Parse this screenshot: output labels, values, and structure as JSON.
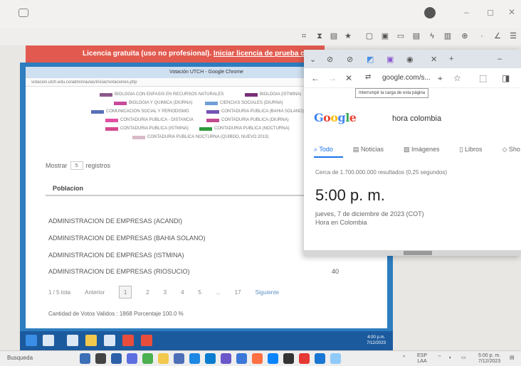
{
  "license": {
    "text": "Licencia gratuita (uso no profesional).",
    "link": "Iniciar licencia de prueba o c"
  },
  "vm": {
    "window_title": "Votación UTCH - Google Chrome",
    "url": "votacion.utch.edu.co/admin/aulas/iniciar/votaciones.php",
    "legend": [
      {
        "label": "BIOLOGIA CON ENFASIS EN RECURSOS NATURALES",
        "color": "#8a5a8a"
      },
      {
        "label": "BIOLOGIA (ISTMINA)",
        "color": "#7a2f7a"
      },
      {
        "label": "BIOLOGIA Y QUIMICA (DIURNA)",
        "color": "#c74a9b"
      },
      {
        "label": "CIENCIAS SOCIALES (DIURNA)",
        "color": "#6f9fd6"
      },
      {
        "label": "COMUNICACION SOCIAL Y PERIODISMO",
        "color": "#5b6fb8"
      },
      {
        "label": "CONTADURIA PUBLICA (BAHIA SOLANO)",
        "color": "#7355b3"
      },
      {
        "label": "CONTADURIA PUBLICA - DISTANCIA",
        "color": "#e04fa0"
      },
      {
        "label": "CONTADURIA PUBLICA (DIURNA)",
        "color": "#c34a8f"
      },
      {
        "label": "CONTADURIA PUBLICA (ISTMINA)",
        "color": "#d64a8e"
      },
      {
        "label": "CONTADURIA PUBLICA (NOCTURNA)",
        "color": "#2e9b3a"
      },
      {
        "label": "CONTADURIA PUBLICA NOCTURNA (QUIBDO, NUEVO 2013)",
        "color": "#d9b9c7"
      }
    ],
    "show_label": "Mostrar",
    "show_value": "5",
    "records_label": "registros",
    "column_header": "Poblacion",
    "rows": [
      {
        "name": "ADMINISTRACION DE EMPRESAS (ACANDI)",
        "value": ""
      },
      {
        "name": "ADMINISTRACION DE EMPRESAS (BAHIA SOLANO)",
        "value": ""
      },
      {
        "name": "ADMINISTRACION DE EMPRESAS (ISTMINA)",
        "value": ""
      },
      {
        "name": "ADMINISTRACION DE EMPRESAS (RIOSUCIO)",
        "value": "40"
      }
    ],
    "pager": {
      "total": "1 / 5 tota",
      "prev": "Anterior",
      "pages": [
        "1",
        "2",
        "3",
        "4",
        "5",
        "...",
        "17"
      ],
      "next": "Siguiente"
    },
    "votes": "Cantidad de Votos Validos : 1868 Porcentaje 100.0 %",
    "taskbar_time": "4:00 p.m.",
    "taskbar_date": "7/12/2023"
  },
  "chrome": {
    "url": "google.com/s...",
    "tooltip": "Interrumpir la carga de esta página",
    "logo": "Google",
    "query": "hora colombia",
    "tabs": [
      "Todo",
      "Noticias",
      "Imágenes",
      "Libros",
      "Sho"
    ],
    "stats": "Cerca de 1.700.000.000 resultados (0,25 segundos)",
    "time": "5:00 p. m.",
    "date": "jueves, 7 de diciembre de 2023 (COT)",
    "subtitle": "Hora en Colombia"
  },
  "host_taskbar": {
    "search": "Busqueda",
    "lang": "ESP",
    "lang2": "LAA",
    "time": "5:00 p. m.",
    "date": "7/12/2023"
  }
}
